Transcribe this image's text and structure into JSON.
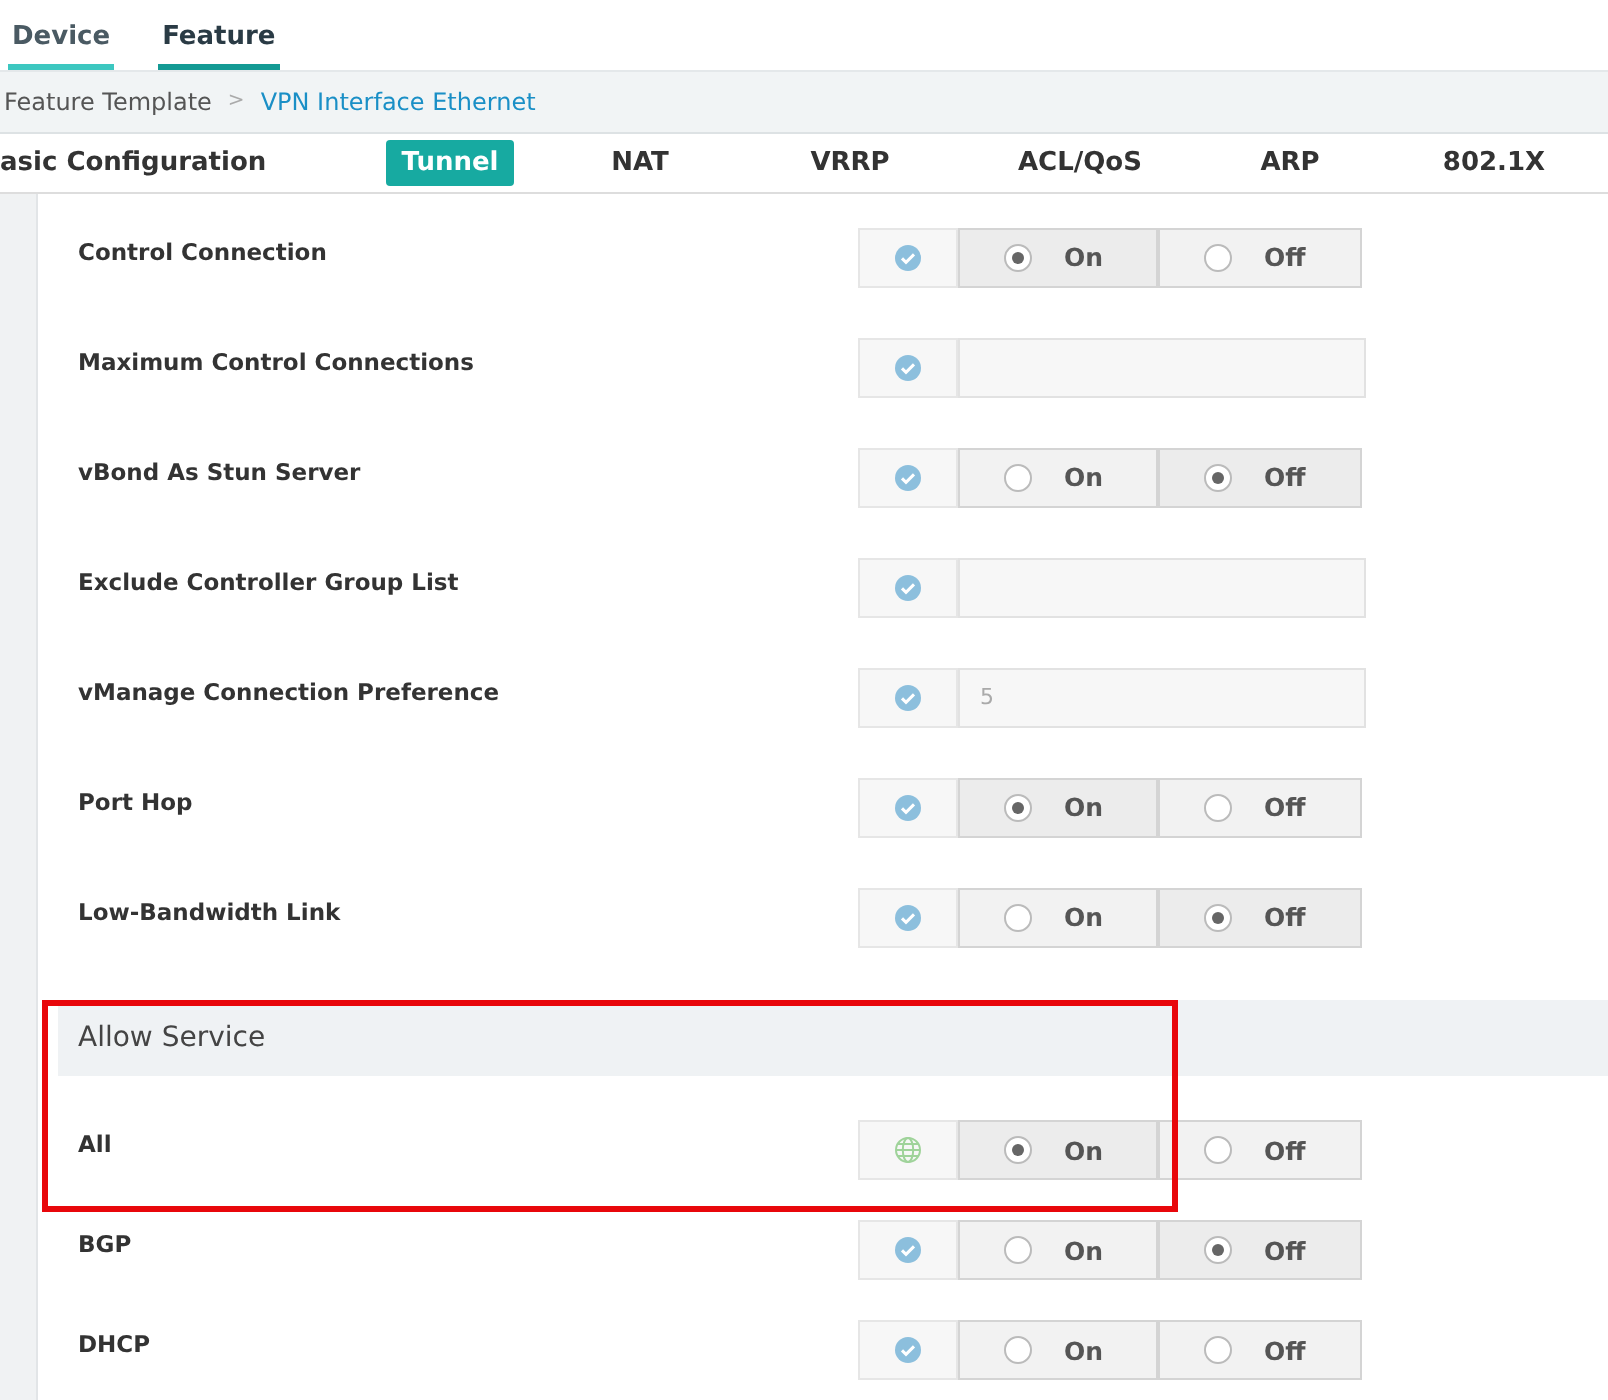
{
  "top_tabs": [
    {
      "label": "Device",
      "selected": false
    },
    {
      "label": "Feature",
      "selected": true
    }
  ],
  "breadcrumb": {
    "separator": ">",
    "items": [
      {
        "label": "Feature Template",
        "link": false
      },
      {
        "label": "VPN Interface Ethernet",
        "link": true
      }
    ]
  },
  "section_tabs": [
    {
      "label": "asic Configuration",
      "selected": false
    },
    {
      "label": "Tunnel",
      "selected": true
    },
    {
      "label": "NAT",
      "selected": false
    },
    {
      "label": "VRRP",
      "selected": false
    },
    {
      "label": "ACL/QoS",
      "selected": false
    },
    {
      "label": "ARP",
      "selected": false
    },
    {
      "label": "802.1X",
      "selected": false
    }
  ],
  "rows": [
    {
      "label": "Control Connection",
      "kind": "toggle",
      "options": [
        {
          "label": "On",
          "selected": true
        },
        {
          "label": "Off",
          "selected": false
        }
      ]
    },
    {
      "label": "Maximum Control Connections",
      "kind": "text"
    },
    {
      "label": "vBond As Stun Server",
      "kind": "toggle",
      "options": [
        {
          "label": "On",
          "selected": false
        },
        {
          "label": "Off",
          "selected": true
        }
      ]
    },
    {
      "label": "Exclude Controller Group List",
      "kind": "text"
    },
    {
      "label": "vManage Connection Preference",
      "kind": "text",
      "value": "5"
    },
    {
      "label": "Port Hop",
      "kind": "toggle",
      "options": [
        {
          "label": "On",
          "selected": true
        },
        {
          "label": "Off",
          "selected": false
        }
      ]
    },
    {
      "label": "Low-Bandwidth Link",
      "kind": "toggle",
      "options": [
        {
          "label": "On",
          "selected": false
        },
        {
          "label": "Off",
          "selected": true
        }
      ]
    }
  ],
  "allow_service": {
    "title": "Allow Service",
    "rows": [
      {
        "label": "All",
        "kind": "toggle",
        "options": [
          {
            "label": "On",
            "selected": true
          },
          {
            "label": "Off",
            "selected": false
          }
        ]
      },
      {
        "label": "BGP",
        "kind": "toggle",
        "options": [
          {
            "label": "On",
            "selected": false
          },
          {
            "label": "Off",
            "selected": true
          }
        ]
      },
      {
        "label": "DHCP",
        "kind": "toggle",
        "options": [
          {
            "label": "On",
            "selected": false
          },
          {
            "label": "Off",
            "selected": false
          }
        ]
      }
    ]
  }
}
